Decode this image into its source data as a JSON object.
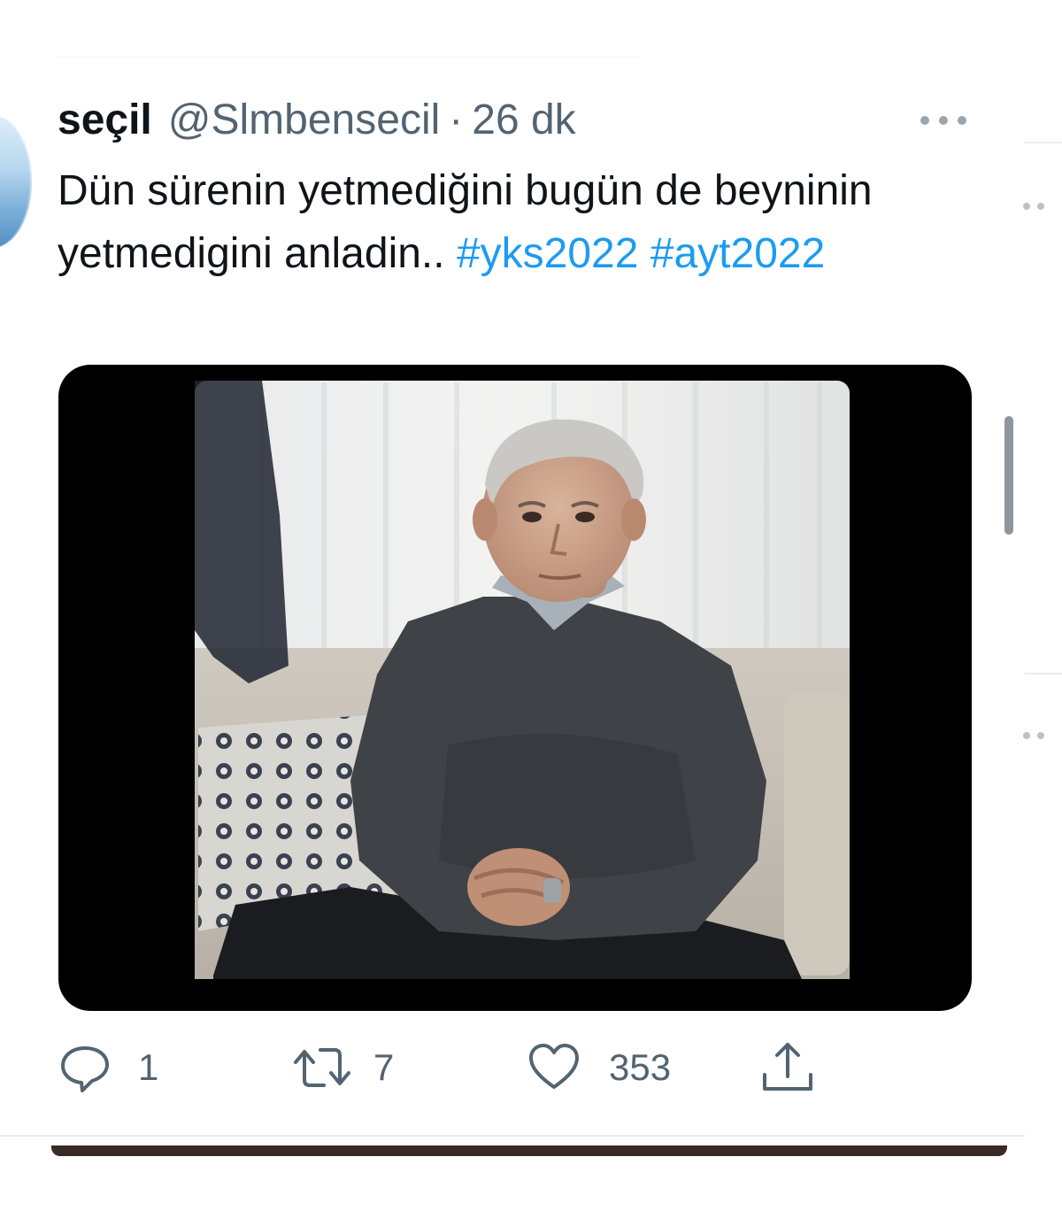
{
  "tweet": {
    "display_name": "seçil",
    "handle": "@Slmbensecil",
    "separator": "·",
    "time": "26 dk",
    "text_plain": "Dün sürenin yetmediğini bugün de beyninin yetmedigini anladin..",
    "hashtags": [
      "#yks2022",
      "#ayt2022"
    ],
    "hashtag_color": "#1d9bf0"
  },
  "actions": {
    "reply_count": "1",
    "retweet_count": "7",
    "like_count": "353"
  },
  "icons": {
    "more": "more-horizontal-icon",
    "reply": "reply-icon",
    "retweet": "retweet-icon",
    "like": "heart-icon",
    "share": "share-icon"
  },
  "colors": {
    "text_primary": "#0f1419",
    "text_secondary": "#536471",
    "accent": "#1d9bf0"
  }
}
